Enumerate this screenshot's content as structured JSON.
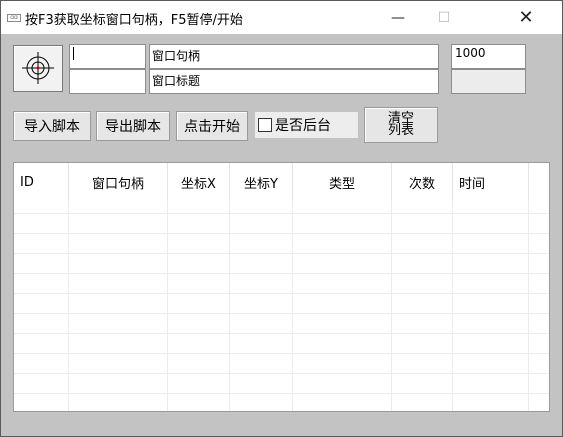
{
  "window": {
    "icon_text": "ɑɑ",
    "title": "按F3获取坐标窗口句柄，F5暂停/开始",
    "minimize": "—",
    "maximize": "☐",
    "close": "✕"
  },
  "top": {
    "coord_field_value": "",
    "handle_label": "窗口句柄",
    "handle_value": "",
    "title_label": "窗口标题",
    "title_value": "",
    "interval_value": "1000"
  },
  "toolbar": {
    "import_label": "导入脚本",
    "export_label": "导出脚本",
    "start_label": "点击开始",
    "background_label": "是否后台",
    "background_checked": false,
    "clear_line1": "清空",
    "clear_line2": "列表"
  },
  "table": {
    "columns": [
      "ID",
      "窗口句柄",
      "坐标X",
      "坐标Y",
      "类型",
      "次数",
      "时间"
    ],
    "rows": []
  }
}
